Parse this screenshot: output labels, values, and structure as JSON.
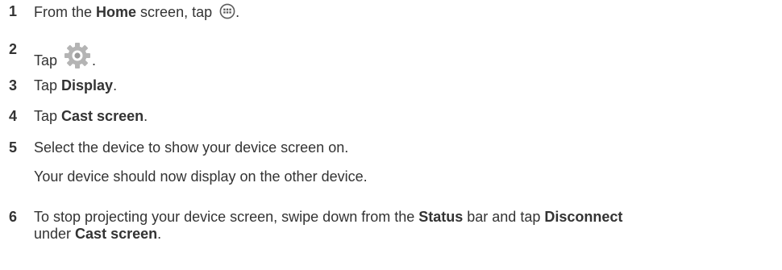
{
  "steps": [
    {
      "number": "1",
      "parts": [
        "From the ",
        "Home",
        " screen, tap ",
        "."
      ],
      "icon": "apps-icon"
    },
    {
      "number": "2",
      "parts": [
        "Tap ",
        "."
      ],
      "icon": "settings-gear-icon"
    },
    {
      "number": "3",
      "parts": [
        "Tap ",
        "Display",
        "."
      ]
    },
    {
      "number": "4",
      "parts": [
        "Tap ",
        "Cast screen",
        "."
      ]
    },
    {
      "number": "5",
      "parts": [
        "Select the device to show your device screen on."
      ],
      "note": "Your device should now display on the other device."
    },
    {
      "number": "6",
      "line1": [
        "To stop projecting your device screen, swipe down from the ",
        "Status",
        " bar and tap ",
        "Disconnect"
      ],
      "line2": [
        "under ",
        "Cast screen",
        "."
      ]
    }
  ]
}
